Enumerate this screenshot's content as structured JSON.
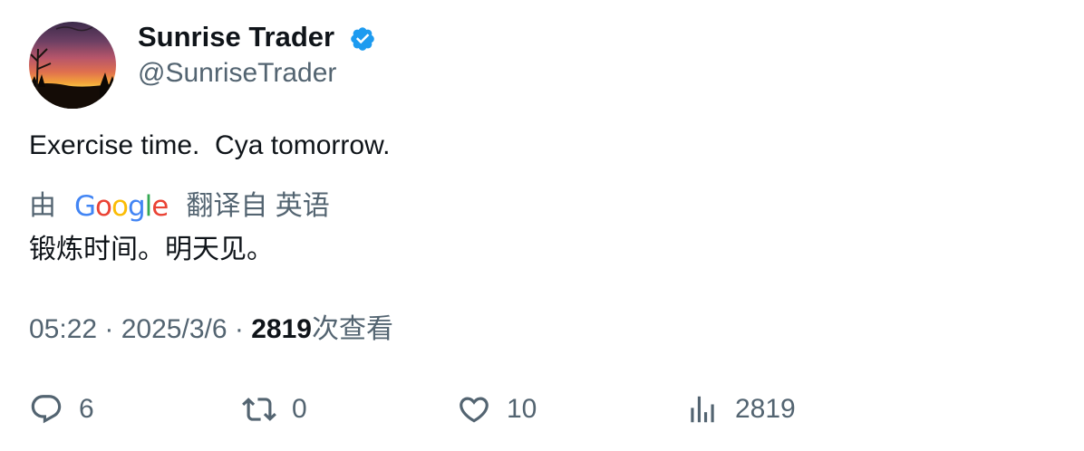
{
  "author": {
    "display_name": "Sunrise Trader",
    "handle": "@SunriseTrader",
    "verified": true,
    "verified_color": "#1d9bf0"
  },
  "tweet": {
    "text": "Exercise time.  Cya tomorrow."
  },
  "translation": {
    "by_label": "由",
    "provider": {
      "letters": [
        {
          "char": "G",
          "color": "#4285F4"
        },
        {
          "char": "o",
          "color": "#EA4335"
        },
        {
          "char": "o",
          "color": "#FBBC05"
        },
        {
          "char": "g",
          "color": "#4285F4"
        },
        {
          "char": "l",
          "color": "#34A853"
        },
        {
          "char": "e",
          "color": "#EA4335"
        }
      ]
    },
    "from_label": "翻译自 英语",
    "text": "锻炼时间。明天见。"
  },
  "meta": {
    "time": "05:22",
    "separator": " · ",
    "date": "2025/3/6",
    "views_count": "2819",
    "views_suffix": "次查看"
  },
  "actions": {
    "reply": {
      "icon": "reply-icon",
      "count": "6"
    },
    "retweet": {
      "icon": "retweet-icon",
      "count": "0"
    },
    "like": {
      "icon": "heart-icon",
      "count": "10"
    },
    "views": {
      "icon": "views-chart-icon",
      "count": "2819"
    }
  },
  "colors": {
    "text_primary": "#0f1419",
    "text_secondary": "#536471"
  }
}
